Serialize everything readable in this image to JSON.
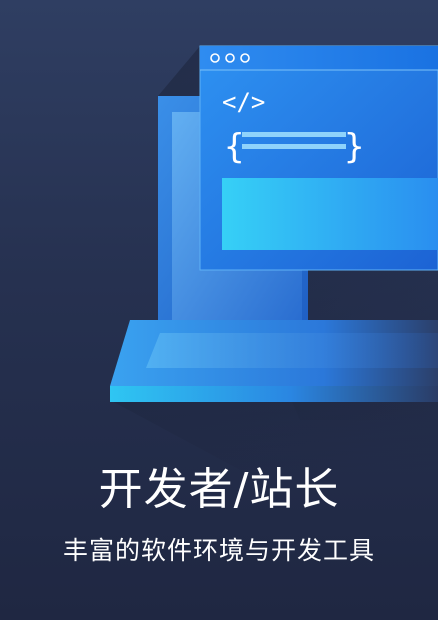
{
  "banner": {
    "title": "开发者/站长",
    "subtitle": "丰富的软件环境与开发工具"
  },
  "illustration": {
    "code_tag_glyph": "</>",
    "brace_open_glyph": "{",
    "brace_close_glyph": "}",
    "icons": [
      "laptop-icon",
      "browser-window-icon",
      "code-tag-icon"
    ],
    "colors": {
      "background_top": "#2f3e62",
      "background_bottom": "#1f2742",
      "accent_blue": "#2a8cf0",
      "accent_cyan": "#38c8f2"
    }
  }
}
